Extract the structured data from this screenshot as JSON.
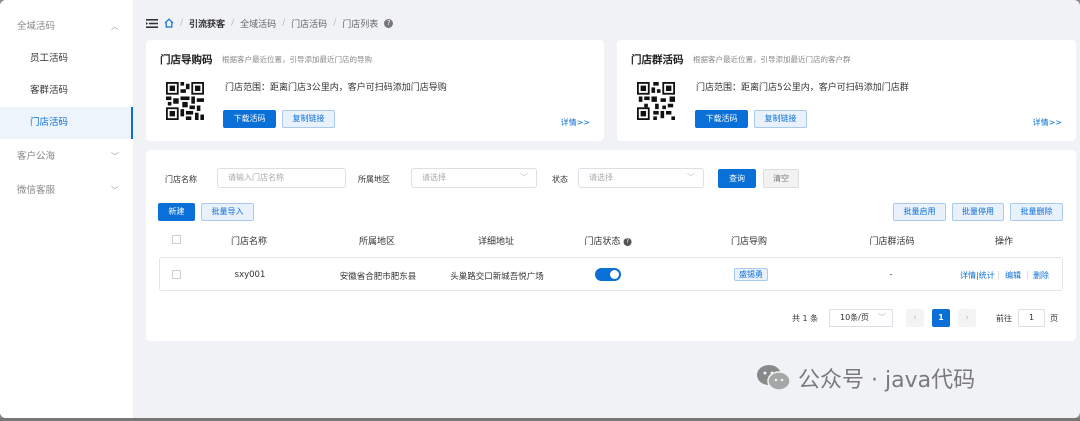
{
  "sidebar": {
    "groups": [
      {
        "label": "全域活码",
        "items": [
          "员工活码",
          "客群活码",
          "门店活码"
        ]
      },
      {
        "label": "客户公海"
      },
      {
        "label": "微信客服"
      }
    ],
    "active": "门店活码"
  },
  "breadcrumb": {
    "items": [
      "引流获客",
      "全域活码",
      "门店活码",
      "门店列表"
    ],
    "separator": "/"
  },
  "cards": [
    {
      "title": "门店导购码",
      "desc": "根据客户最近位置，引导添加最近门店的导购",
      "scope": "门店范围：距离门店3公里内，客户可扫码添加门店导购",
      "download_label": "下载活码",
      "copy_label": "复制链接",
      "details_label": "详情>>"
    },
    {
      "title": "门店群活码",
      "desc": "根据客户最近位置，引导添加最近门店的客户群",
      "scope": "门店范围：距离门店5公里内，客户可扫码添加门店群",
      "download_label": "下载活码",
      "copy_label": "复制链接",
      "details_label": "详情>>"
    }
  ],
  "filters": {
    "store_name_label": "门店名称",
    "store_name_placeholder": "请输入门店名称",
    "region_label": "所属地区",
    "region_placeholder": "请选择",
    "status_label": "状态",
    "status_placeholder": "请选择",
    "search_label": "查询",
    "clear_label": "清空"
  },
  "actions": {
    "new_label": "新建",
    "import_label": "批量导入",
    "enable_label": "批量启用",
    "disable_label": "批量停用",
    "delete_label": "批量删除"
  },
  "table": {
    "headers": [
      "门店名称",
      "所属地区",
      "详细地址",
      "门店状态",
      "门店导购",
      "门店群活码",
      "操作"
    ],
    "rows": [
      {
        "name": "sxy001",
        "region": "安徽省合肥市肥东县",
        "address": "头巢路交口新城吾悦广场",
        "status_on": true,
        "guide": "盛锡勇",
        "group_code": "-",
        "ops": [
          "详情|统计",
          "编辑",
          "删除"
        ]
      }
    ]
  },
  "pagination": {
    "total_label": "共 1 条",
    "page_size": "10条/页",
    "current_page": "1",
    "goto_label": "前往",
    "goto_value": "1",
    "page_suffix": "页"
  },
  "watermark": {
    "text": "公众号 · java代码"
  },
  "colors": {
    "primary": "#0a6fd6",
    "sidebar_active_bg": "#eef4fc"
  }
}
